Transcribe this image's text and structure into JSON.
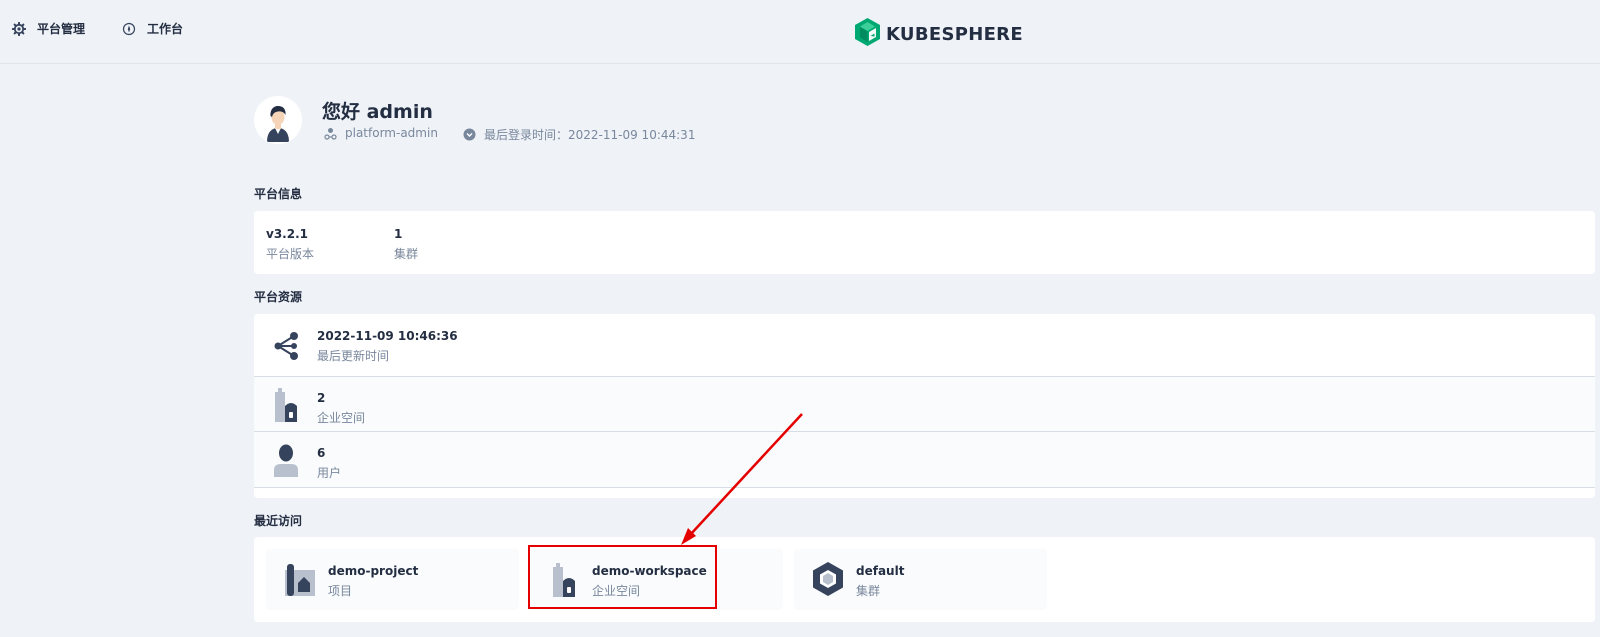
{
  "nav": {
    "platform_label": "平台管理",
    "workbench_label": "工作台"
  },
  "brand": {
    "name": "KUBESPHERE",
    "color": "#00a971"
  },
  "user": {
    "greeting": "您好 admin",
    "role": "platform-admin",
    "last_login": "最后登录时间：2022-11-09 10:44:31"
  },
  "platform_info": {
    "title": "平台信息",
    "items": [
      {
        "value": "v3.2.1",
        "label": "平台版本"
      },
      {
        "value": "1",
        "label": "集群"
      }
    ]
  },
  "platform_resources": {
    "title": "平台资源",
    "items": [
      {
        "value": "2022-11-09 10:46:36",
        "label": "最后更新时间",
        "icon": "share-nodes-icon"
      },
      {
        "value": "2",
        "label": "企业空间",
        "icon": "workspace-icon"
      },
      {
        "value": "6",
        "label": "用户",
        "icon": "user-icon"
      }
    ]
  },
  "recent": {
    "title": "最近访问",
    "items": [
      {
        "name": "demo-project",
        "type": "项目",
        "icon": "project-icon"
      },
      {
        "name": "demo-workspace",
        "type": "企业空间",
        "icon": "workspace-icon"
      },
      {
        "name": "default",
        "type": "集群",
        "icon": "cluster-icon"
      }
    ]
  },
  "annotation": {
    "color": "#e50000"
  }
}
